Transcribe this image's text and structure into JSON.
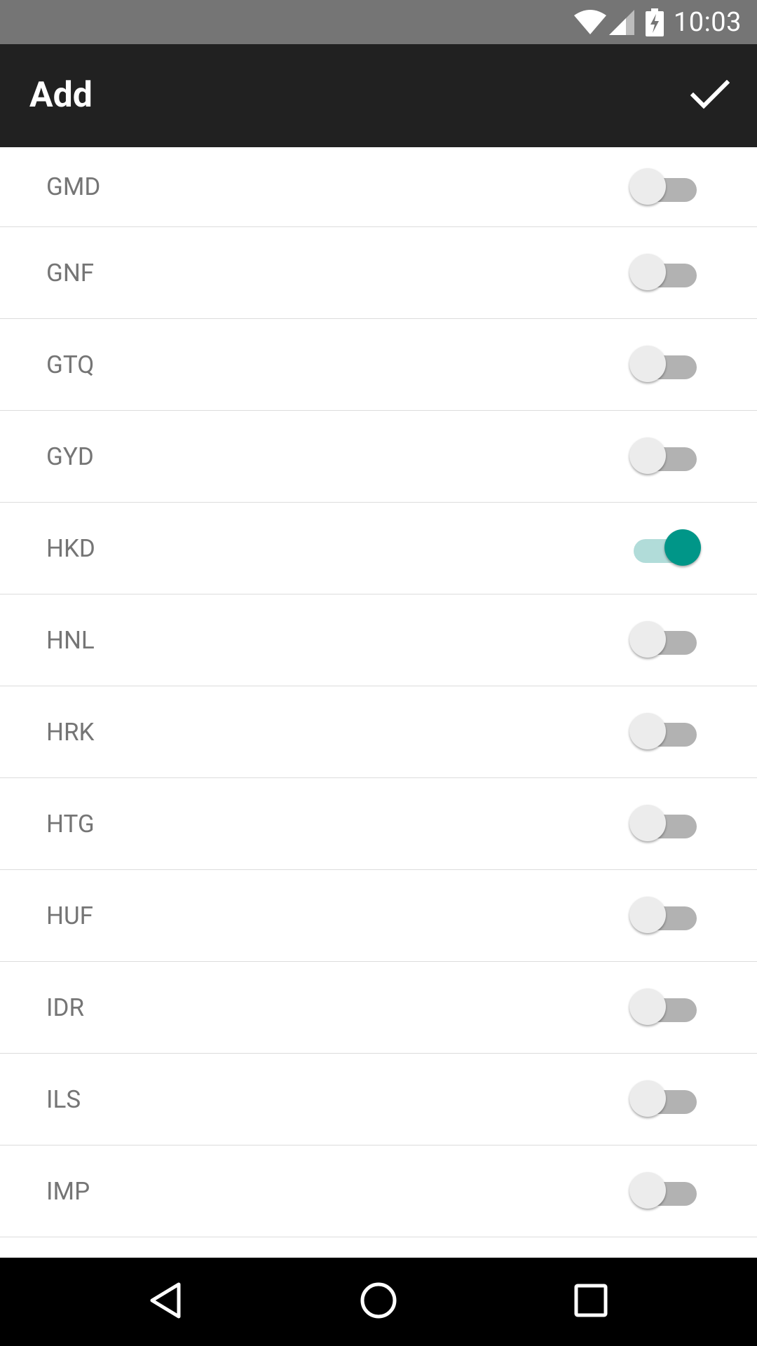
{
  "status_bar": {
    "time": "10:03",
    "icons": [
      "wifi-icon",
      "cell-signal-icon",
      "battery-charging-icon"
    ]
  },
  "app_bar": {
    "title": "Add",
    "confirm_icon": "check-icon"
  },
  "currencies": [
    {
      "code": "GMD",
      "enabled": false
    },
    {
      "code": "GNF",
      "enabled": false
    },
    {
      "code": "GTQ",
      "enabled": false
    },
    {
      "code": "GYD",
      "enabled": false
    },
    {
      "code": "HKD",
      "enabled": true
    },
    {
      "code": "HNL",
      "enabled": false
    },
    {
      "code": "HRK",
      "enabled": false
    },
    {
      "code": "HTG",
      "enabled": false
    },
    {
      "code": "HUF",
      "enabled": false
    },
    {
      "code": "IDR",
      "enabled": false
    },
    {
      "code": "ILS",
      "enabled": false
    },
    {
      "code": "IMP",
      "enabled": false
    }
  ],
  "nav_bar": {
    "buttons": [
      "back-icon",
      "home-icon",
      "recents-icon"
    ]
  },
  "colors": {
    "status_bar": "#757575",
    "app_bar": "#212121",
    "accent": "#009688",
    "accent_track": "#b1dcd9",
    "switch_off_track": "#b2b2b2",
    "switch_off_thumb": "#ececec"
  }
}
